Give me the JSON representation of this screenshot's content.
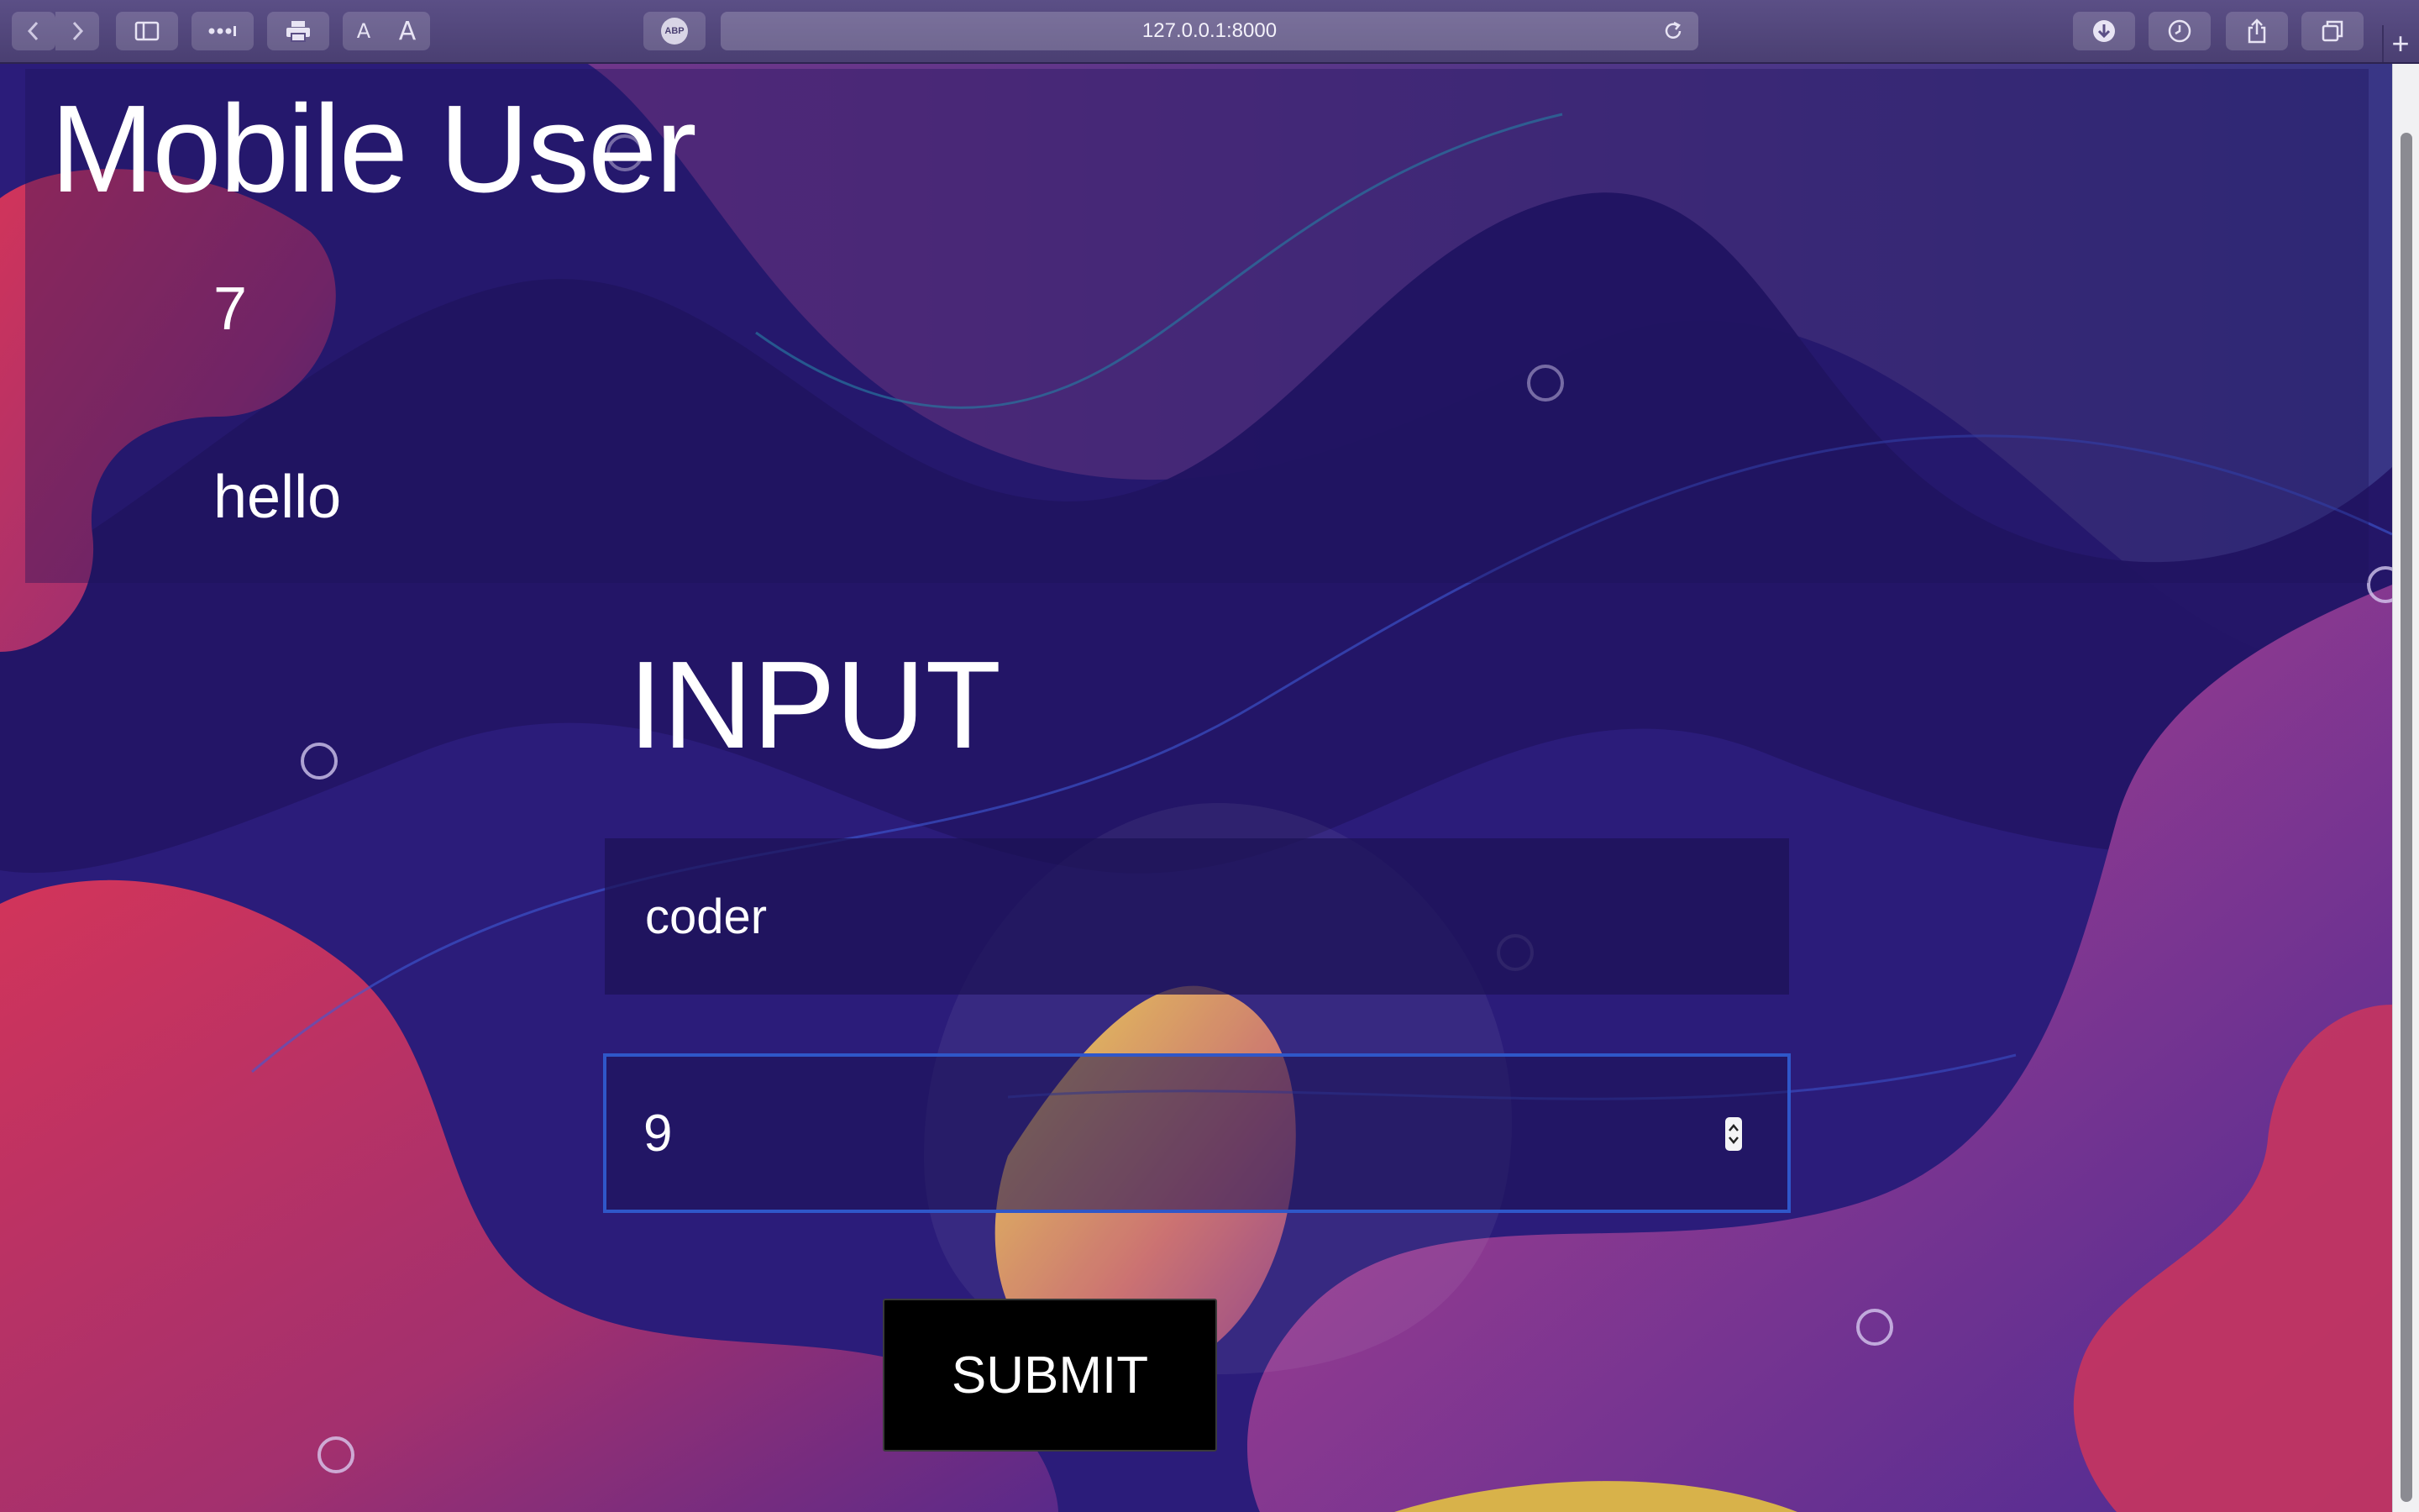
{
  "browser": {
    "url": "127.0.0.1:8000",
    "text_size_small": "A",
    "text_size_large": "A",
    "adblock_label": "ABP",
    "new_tab": "+"
  },
  "colors": {
    "page_bg": "#2b1c7a",
    "blob_pink": "#c8355f",
    "blob_purple": "#7a3aa0",
    "blob_yellow": "#d8c04a",
    "input_focus_border": "#2f57c9",
    "button_bg": "#000000"
  },
  "header": {
    "title": "Mobile User",
    "count": "7",
    "message": "hello"
  },
  "form": {
    "title": "INPUT",
    "name_value": "coder",
    "number_value": "9",
    "submit_label": "SUBMIT"
  },
  "icons": {
    "back": "chevron-left-icon",
    "forward": "chevron-right-icon",
    "sidebar": "sidebar-icon",
    "more": "ellipsis-icon",
    "print": "printer-icon",
    "reload": "reload-icon",
    "downloads": "download-icon",
    "history": "clock-icon",
    "share": "share-icon",
    "tabs": "tab-overview-icon"
  }
}
